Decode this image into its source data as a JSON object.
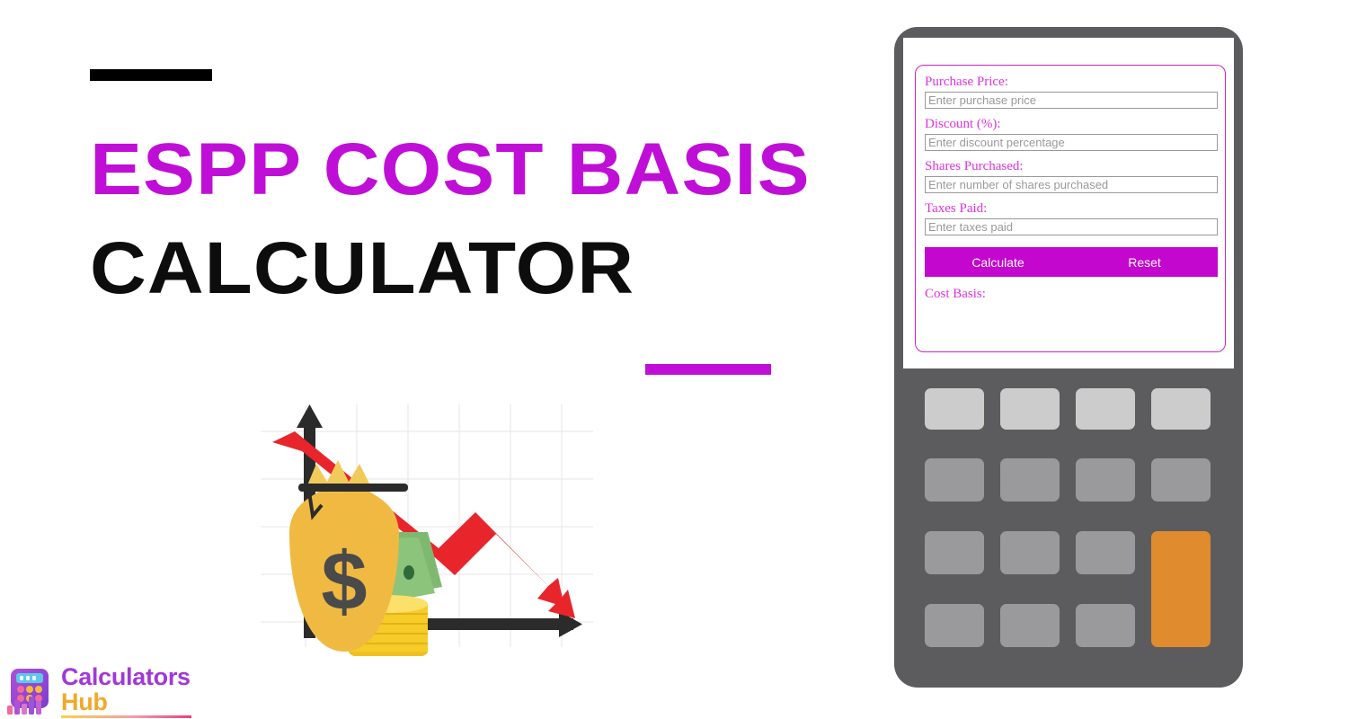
{
  "page": {
    "background_color": "#ffffff",
    "accent_color": "#bf0fd6",
    "dark_color": "#0d0d0d"
  },
  "hero": {
    "title_line1": "ESPP COST BASIS",
    "title_line2": "CALCULATOR",
    "top_rule_color": "#000000",
    "mid_rule_color": "#bf0fd6"
  },
  "logo": {
    "word1": "Calculators",
    "word2": "Hub",
    "word1_color": "#a238d8",
    "word2_color": "#f0a92a",
    "mark_name": "calculator-bar-chart-logo-icon"
  },
  "illustration": {
    "name": "declining-stock-money-bag-illustration",
    "elements": [
      "money-bag-dollar-icon",
      "cash-bills-icon",
      "gold-coin-stack-icon",
      "red-down-trend-arrow",
      "black-axis-arrows",
      "light-grid-background"
    ],
    "arrow_color": "#e8252b",
    "bag_color": "#f0b942",
    "axis_color": "#2b2b2b",
    "grid_color": "#e8e8e8"
  },
  "device": {
    "frame_color": "#5c5c5e",
    "screen_color": "#ffffff",
    "keypad": {
      "rows": 4,
      "cols": 4,
      "light_key_color": "#cccccc",
      "mid_key_color": "#9a9a9c",
      "accent_key_color": "#e08b2e"
    }
  },
  "form": {
    "border_color": "#cc22cc",
    "label_color": "#dd33dd",
    "fields": [
      {
        "label": "Purchase Price:",
        "placeholder": "Enter purchase price",
        "value": ""
      },
      {
        "label": "Discount (%):",
        "placeholder": "Enter discount percentage",
        "value": ""
      },
      {
        "label": "Shares Purchased:",
        "placeholder": "Enter number of shares purchased",
        "value": ""
      },
      {
        "label": "Taxes Paid:",
        "placeholder": "Enter taxes paid",
        "value": ""
      }
    ],
    "buttons": {
      "calculate_label": "Calculate",
      "reset_label": "Reset",
      "bar_color": "#c307cf",
      "text_color": "#ffffff"
    },
    "result": {
      "label": "Cost Basis:",
      "value": ""
    }
  }
}
